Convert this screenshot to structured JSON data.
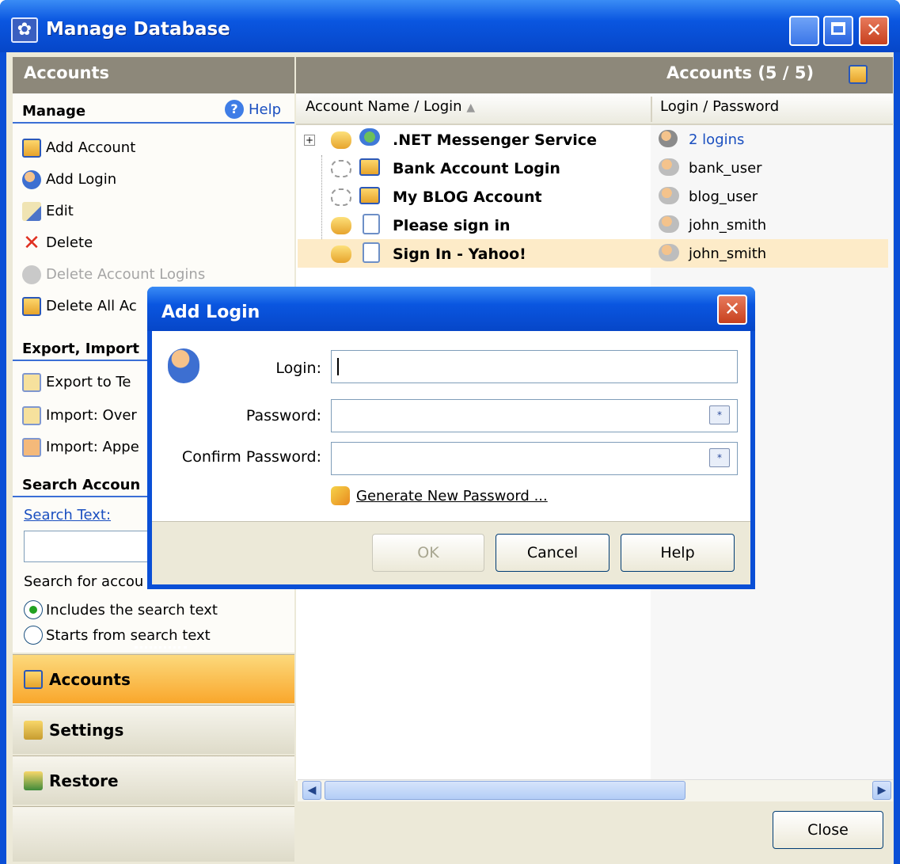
{
  "window": {
    "title": "Manage Database",
    "app_icon": "app-logo-icon"
  },
  "left": {
    "header": "Accounts",
    "manage": {
      "title": "Manage",
      "help": "Help",
      "actions": [
        {
          "label": "Add Account",
          "icon": "add-account-icon"
        },
        {
          "label": "Add Login",
          "icon": "add-login-icon"
        },
        {
          "label": "Edit",
          "icon": "edit-icon"
        },
        {
          "label": "Delete",
          "icon": "delete-icon"
        },
        {
          "label": "Delete Account Logins",
          "icon": "delete-logins-icon"
        },
        {
          "label": "Delete All Ac",
          "icon": "delete-all-icon"
        }
      ]
    },
    "export": {
      "title": "Export, Import",
      "actions": [
        {
          "label": "Export to Te",
          "icon": "export-icon"
        },
        {
          "label": "Import: Over",
          "icon": "import-overwrite-icon"
        },
        {
          "label": "Import: Appe",
          "icon": "import-append-icon"
        }
      ]
    },
    "search": {
      "title": "Search Accoun",
      "text_label": "Search Text:",
      "value": "",
      "for_label": "Search for accou",
      "options": [
        "Includes the search text",
        "Starts from search text"
      ],
      "selected": 0
    },
    "nav": [
      "Accounts",
      "Settings",
      "Restore"
    ]
  },
  "right": {
    "header": "Accounts (5 / 5)",
    "columns": [
      "Account Name / Login",
      "Login / Password"
    ],
    "rows": [
      {
        "name": ".NET Messenger Service",
        "login": "2 logins"
      },
      {
        "name": "Bank Account Login",
        "login": "bank_user"
      },
      {
        "name": "My BLOG Account",
        "login": "blog_user"
      },
      {
        "name": "Please sign in",
        "login": "john_smith"
      },
      {
        "name": "Sign In - Yahoo!",
        "login": "john_smith"
      }
    ],
    "close": "Close"
  },
  "dialog": {
    "title": "Add Login",
    "login_label": "Login:",
    "login_value": "",
    "password_label": "Password:",
    "confirm_label": "Confirm Password:",
    "generate": "Generate New Password ...",
    "ok": "OK",
    "cancel": "Cancel",
    "help": "Help"
  },
  "colors": {
    "title_blue": "#0a56e0",
    "header_grey": "#8d887a",
    "selected_row": "#fdebc8",
    "nav_active": "#fbb33c"
  }
}
